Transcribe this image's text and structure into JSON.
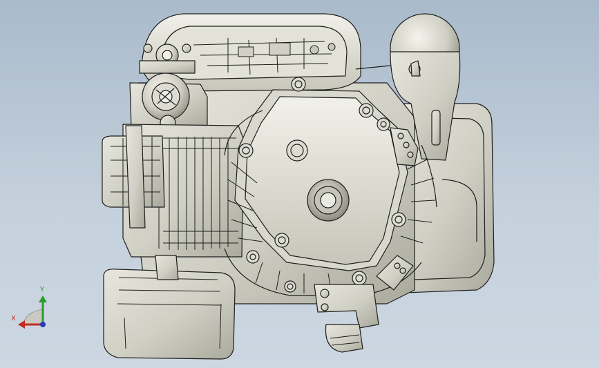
{
  "viewport": {
    "background_top": "#a9bacb",
    "background_bottom": "#ccd7e2",
    "model_shade": "#d6d6cc",
    "model_edge": "#1e1e1e"
  },
  "triad": {
    "y_label": "Y",
    "x_label": "X",
    "y_color": "#2c9a2c",
    "x_color": "#c42a22",
    "z_color": "#2c3ab8"
  }
}
